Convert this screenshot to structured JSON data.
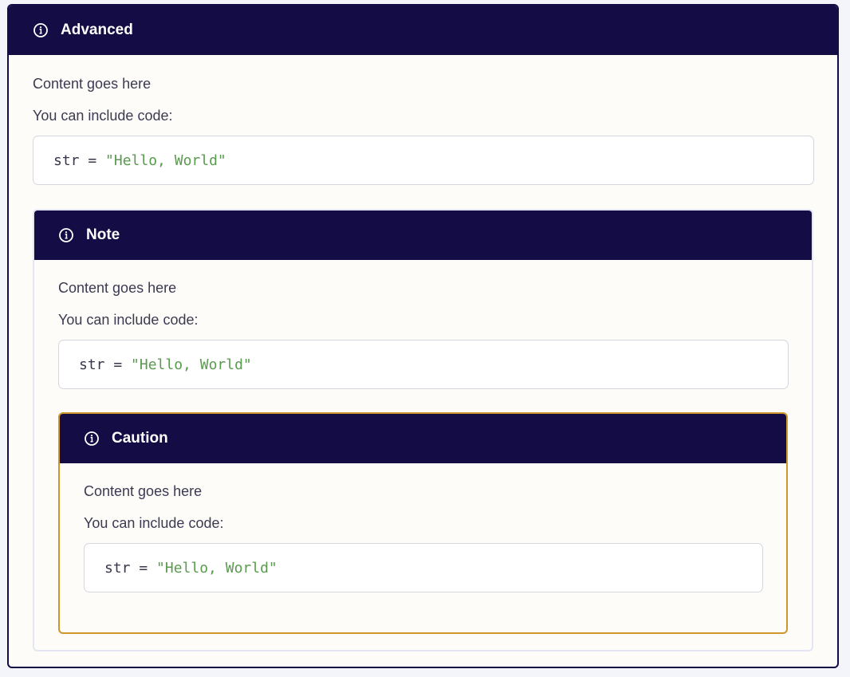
{
  "advanced": {
    "title": "Advanced",
    "content_line": "Content goes here",
    "code_intro": "You can include code:",
    "code": {
      "var": "str",
      "op": " = ",
      "string": "\"Hello, World\""
    }
  },
  "note": {
    "title": "Note",
    "content_line": "Content goes here",
    "code_intro": "You can include code:",
    "code": {
      "var": "str",
      "op": " = ",
      "string": "\"Hello, World\""
    }
  },
  "caution": {
    "title": "Caution",
    "content_line": "Content goes here",
    "code_intro": "You can include code:",
    "code": {
      "var": "str",
      "op": " = ",
      "string": "\"Hello, World\""
    }
  },
  "icon": "info-icon",
  "colors": {
    "header_bg": "#140c44",
    "caution_border": "#cf962e",
    "string_green": "#5a9a4f"
  }
}
